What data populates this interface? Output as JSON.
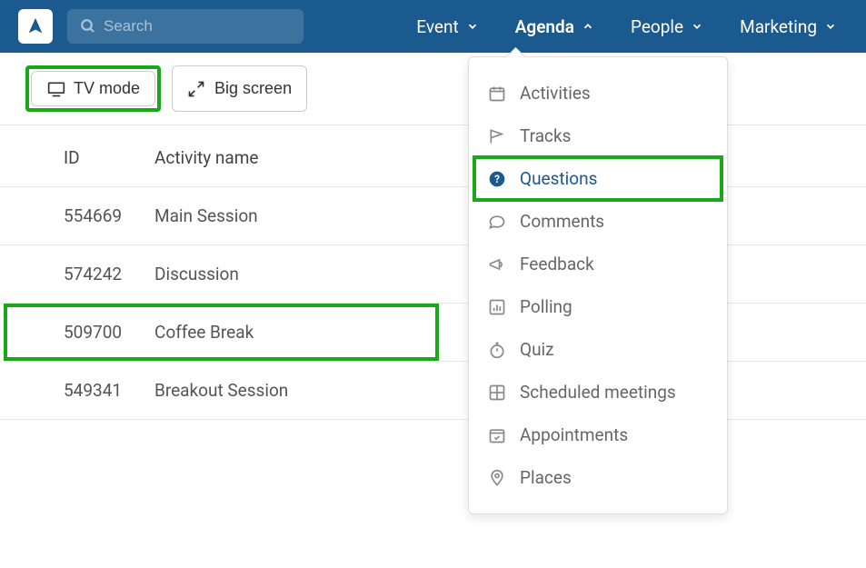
{
  "nav": {
    "search_placeholder": "Search",
    "items": [
      {
        "label": "Event"
      },
      {
        "label": "Agenda"
      },
      {
        "label": "People"
      },
      {
        "label": "Marketing"
      }
    ]
  },
  "toolbar": {
    "tv_mode_label": "TV mode",
    "big_screen_label": "Big screen"
  },
  "table": {
    "headers": {
      "id": "ID",
      "name": "Activity name"
    },
    "rows": [
      {
        "id": "554669",
        "name": "Main Session"
      },
      {
        "id": "574242",
        "name": "Discussion"
      },
      {
        "id": "509700",
        "name": "Coffee Break"
      },
      {
        "id": "549341",
        "name": "Breakout Session"
      }
    ]
  },
  "dropdown": {
    "items": [
      {
        "label": "Activities"
      },
      {
        "label": "Tracks"
      },
      {
        "label": "Questions"
      },
      {
        "label": "Comments"
      },
      {
        "label": "Feedback"
      },
      {
        "label": "Polling"
      },
      {
        "label": "Quiz"
      },
      {
        "label": "Scheduled meetings"
      },
      {
        "label": "Appointments"
      },
      {
        "label": "Places"
      }
    ]
  }
}
